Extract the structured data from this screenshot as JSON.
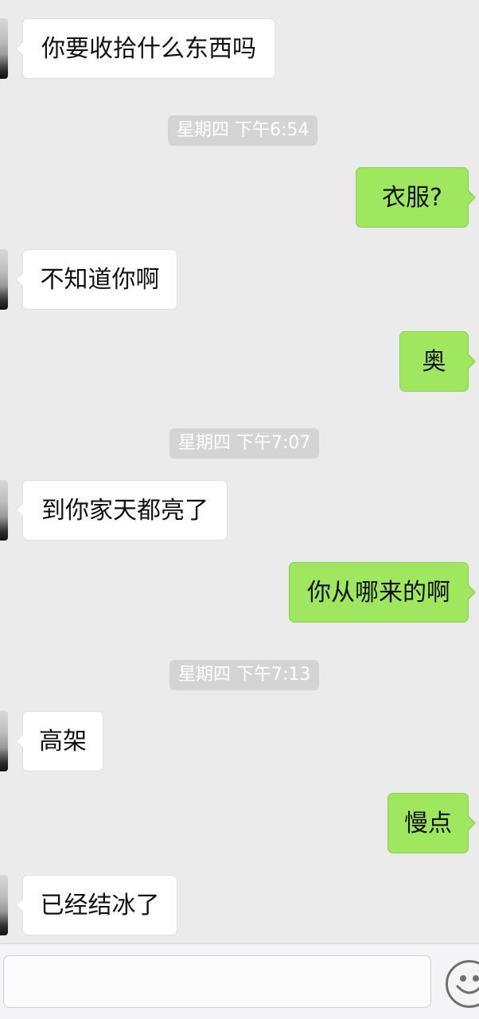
{
  "conversation": {
    "messages": [
      {
        "type": "message",
        "direction": "incoming",
        "text": "你要收拾什么东西吗"
      },
      {
        "type": "timestamp",
        "text": "星期四 下午6:54"
      },
      {
        "type": "message",
        "direction": "outgoing",
        "text": "衣服?"
      },
      {
        "type": "message",
        "direction": "incoming",
        "text": "不知道你啊"
      },
      {
        "type": "message",
        "direction": "outgoing",
        "text": "奥"
      },
      {
        "type": "timestamp",
        "text": "星期四 下午7:07"
      },
      {
        "type": "message",
        "direction": "incoming",
        "text": "到你家天都亮了"
      },
      {
        "type": "message",
        "direction": "outgoing",
        "text": "你从哪来的啊"
      },
      {
        "type": "timestamp",
        "text": "星期四 下午7:13"
      },
      {
        "type": "message",
        "direction": "incoming",
        "text": "高架"
      },
      {
        "type": "message",
        "direction": "outgoing",
        "text": "慢点"
      },
      {
        "type": "message",
        "direction": "incoming",
        "text": "已经结冰了"
      }
    ]
  },
  "input_bar": {
    "value": "",
    "emoji_icon": "emoji-smiley-icon"
  },
  "colors": {
    "background": "#ebebeb",
    "incoming_bubble": "#ffffff",
    "outgoing_bubble": "#9fe75e",
    "timestamp_bg": "#d4d4d4"
  }
}
